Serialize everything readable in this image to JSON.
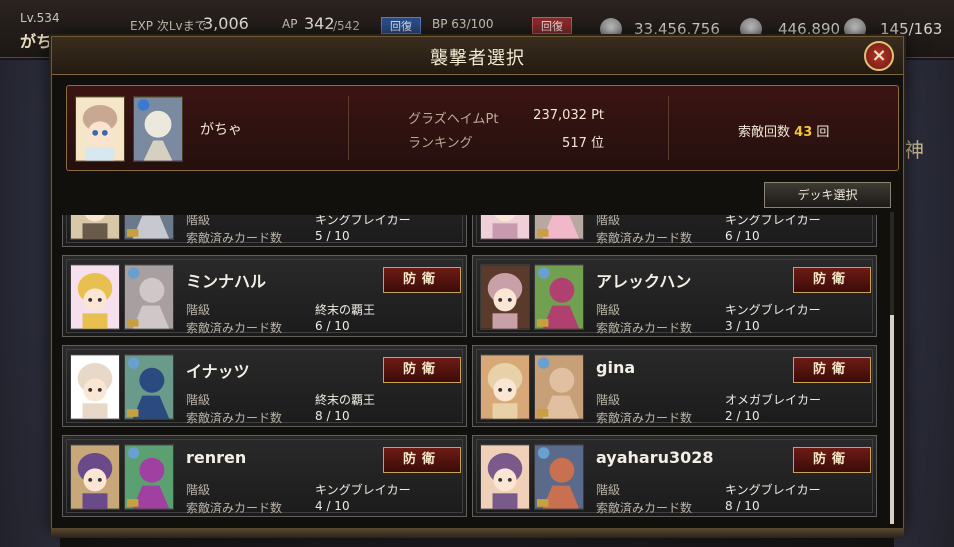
{
  "hud": {
    "level": "Lv.534",
    "name": "がち",
    "exp_label": "EXP 次Lvまで",
    "exp_value": "3,006",
    "ap_label": "AP",
    "ap_value": "342",
    "ap_max": "/542",
    "recover_label": "回復",
    "bp_label": "BP 63/100",
    "coin1": "33,456,756",
    "coin2": "446,890",
    "coin3": "145/163",
    "side_text": "神"
  },
  "modal": {
    "title": "襲撃者選択",
    "close_label": "×",
    "player": {
      "name": "がちゃ",
      "pt_label": "グラズヘイムPt",
      "pt_value": "237,032 Pt",
      "rank_label": "ランキング",
      "rank_value": "517 位",
      "search_prefix": "索敵回数",
      "search_count": "43",
      "search_suffix": "回"
    },
    "deck_button": "デッキ選択",
    "defend_label": "防衛",
    "rank_label": "階級",
    "cards_label": "索敵済みカード数",
    "opponents": [
      {
        "name": "",
        "rank": "キングブレイカー",
        "cards": "5 / 10",
        "partial": true
      },
      {
        "name": "",
        "rank": "キングブレイカー",
        "cards": "6 / 10",
        "partial": true
      },
      {
        "name": "ミンナハル",
        "rank": "終末の覇王",
        "cards": "6 / 10"
      },
      {
        "name": "アレックハン",
        "rank": "キングブレイカー",
        "cards": "3 / 10"
      },
      {
        "name": "イナッツ",
        "rank": "終末の覇王",
        "cards": "8 / 10"
      },
      {
        "name": "gina",
        "rank": "オメガブレイカー",
        "cards": "2 / 10"
      },
      {
        "name": "renren",
        "rank": "キングブレイカー",
        "cards": "4 / 10"
      },
      {
        "name": "ayaharu3028",
        "rank": "キングブレイカー",
        "cards": "8 / 10"
      }
    ]
  }
}
